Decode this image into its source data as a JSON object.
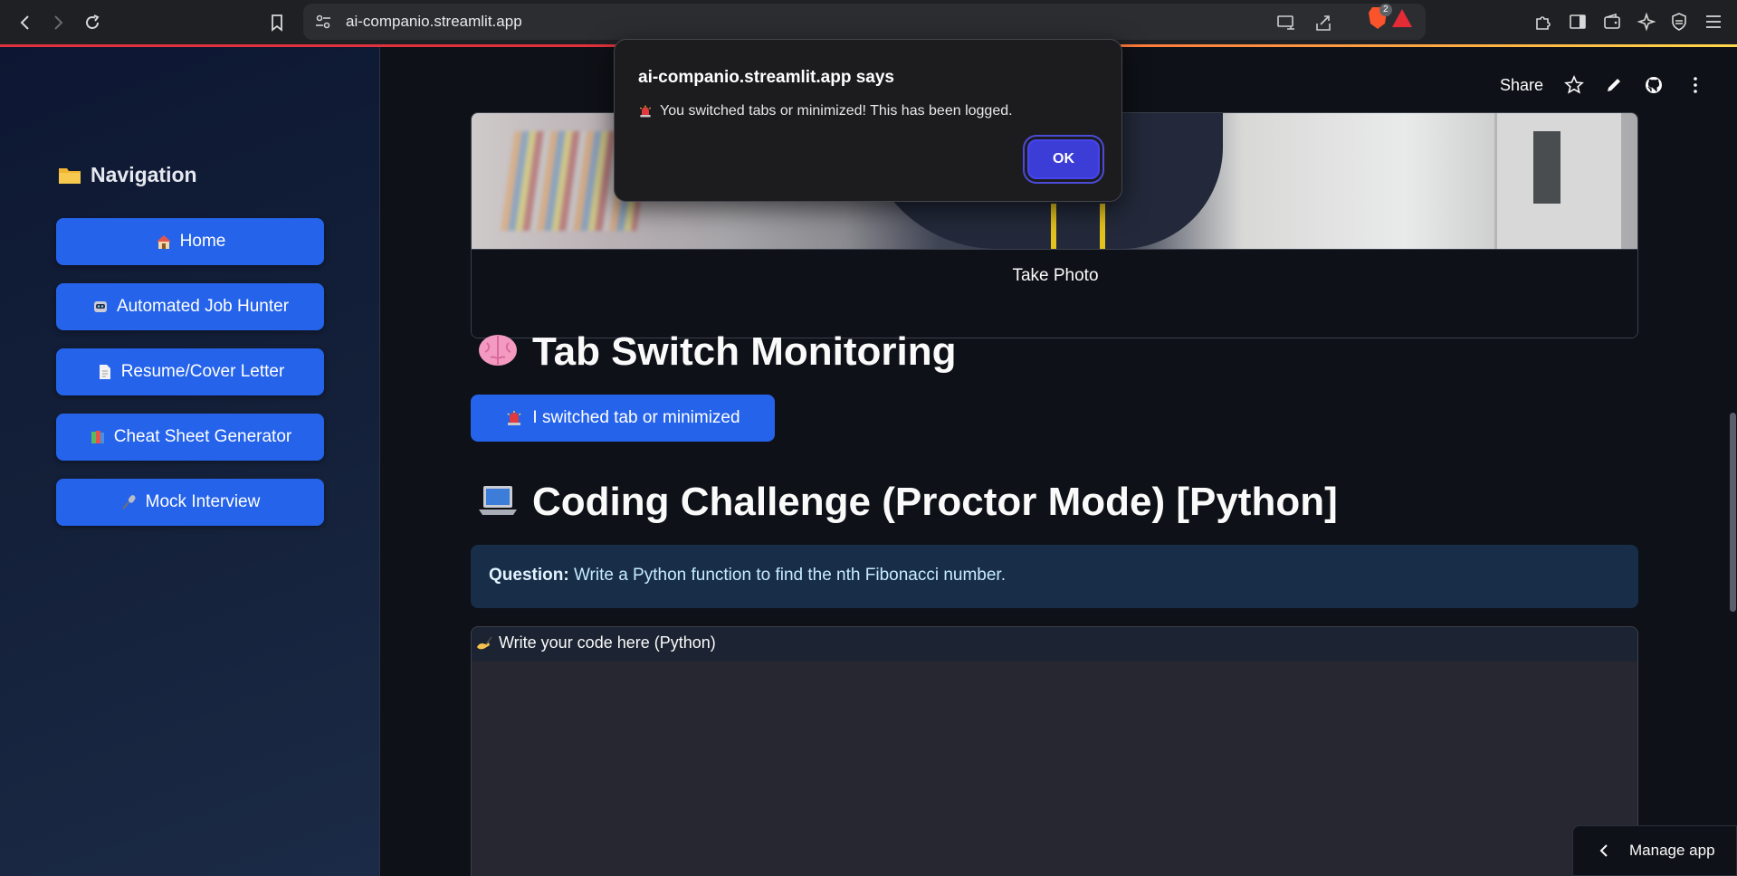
{
  "browser": {
    "url": "ai-companio.streamlit.app",
    "extension_badge_count": "2",
    "icons": [
      "back-icon",
      "forward-icon",
      "reload-icon",
      "bookmark-icon",
      "site-settings-icon",
      "cast-icon",
      "share-icon",
      "brave-shields-icon",
      "brave-rewards-icon",
      "extensions-icon",
      "sidebar-icon",
      "wallet-icon",
      "leo-ai-icon",
      "vpn-icon",
      "menu-icon"
    ]
  },
  "dialog": {
    "title": "ai-companio.streamlit.app says",
    "message": "You switched tabs or minimized! This has been logged.",
    "message_icon": "siren-icon",
    "ok_label": "OK"
  },
  "sidebar": {
    "title": "Navigation",
    "title_icon": "folder-icon",
    "items": [
      {
        "label": "Home",
        "icon": "house-icon"
      },
      {
        "label": "Automated Job Hunter",
        "icon": "robot-icon"
      },
      {
        "label": "Resume/Cover Letter",
        "icon": "document-icon"
      },
      {
        "label": "Cheat Sheet Generator",
        "icon": "books-icon"
      },
      {
        "label": "Mock Interview",
        "icon": "microphone-icon"
      }
    ]
  },
  "toolbar": {
    "share_label": "Share",
    "icons": [
      "star-icon",
      "edit-icon",
      "github-icon",
      "more-icon"
    ]
  },
  "camera": {
    "take_photo_label": "Take Photo"
  },
  "sections": {
    "tab_switch_heading": "Tab Switch Monitoring",
    "tab_switch_icon": "brain-icon",
    "switch_button_label": "I switched tab or minimized",
    "switch_button_icon": "siren-icon",
    "coding_heading": "Coding Challenge (Proctor Mode) [Python]",
    "coding_icon": "laptop-icon",
    "question_label": "Question:",
    "question_text": "Write a Python function to find the nth Fibonacci number.",
    "code_label": "Write your code here (Python)",
    "code_label_icon": "writing-hand-icon",
    "code_value": ""
  },
  "manage_app": {
    "label": "Manage app"
  },
  "colors": {
    "accent_blue": "#2563eb",
    "background": "#0e1117",
    "dialog_ok": "#3c3cd6",
    "info_bg": "#172d48"
  }
}
